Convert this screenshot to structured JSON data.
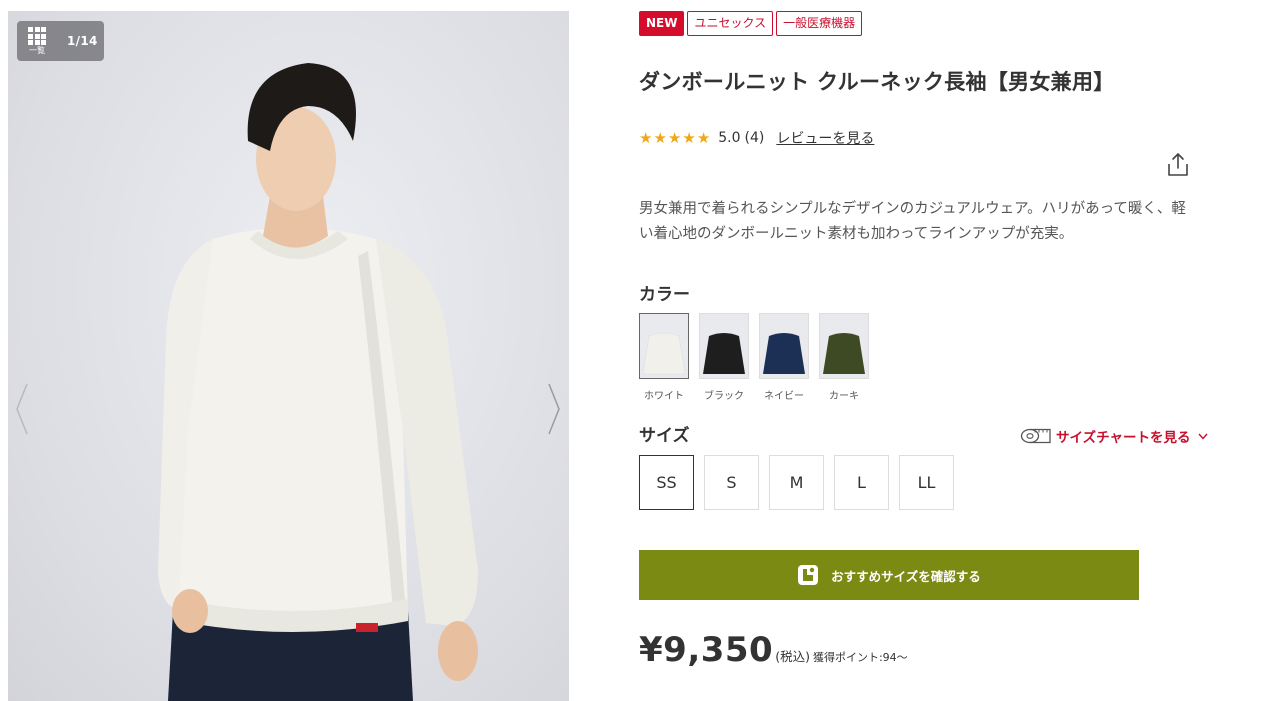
{
  "gallery": {
    "grid_label": "一覧",
    "counter": "1/14"
  },
  "badges": [
    "NEW",
    "ユニセックス",
    "一般医療機器"
  ],
  "product": {
    "title": "ダンボールニット クルーネック長袖【男女兼用】",
    "rating": {
      "stars": 5,
      "score": "5.0",
      "count": "(4)",
      "review_link": "レビューを見る"
    },
    "description": "男女兼用で着られるシンプルなデザインのカジュアルウェア。ハリがあって暖く、軽い着心地のダンボールニット素材も加わってラインアップが充実。"
  },
  "color_section": {
    "label": "カラー",
    "options": [
      {
        "name": "ホワイト",
        "swatch": "#f2f0ea",
        "selected": true
      },
      {
        "name": "ブラック",
        "swatch": "#1e1e1e",
        "selected": false
      },
      {
        "name": "ネイビー",
        "swatch": "#1c2f55",
        "selected": false
      },
      {
        "name": "カーキ",
        "swatch": "#3d4a24",
        "selected": false
      }
    ]
  },
  "size_section": {
    "label": "サイズ",
    "chart_link": "サイズチャートを見る",
    "options": [
      "SS",
      "S",
      "M",
      "L",
      "LL"
    ],
    "selected": "SS"
  },
  "recommend_button": "おすすめサイズを確認する",
  "price": {
    "value": "¥9,350",
    "tax": "(税込)",
    "points": "獲得ポイント:94〜"
  },
  "colors": {
    "accent_red": "#c8102e",
    "cta_olive": "#7a8a13",
    "star": "#f0a81a"
  }
}
